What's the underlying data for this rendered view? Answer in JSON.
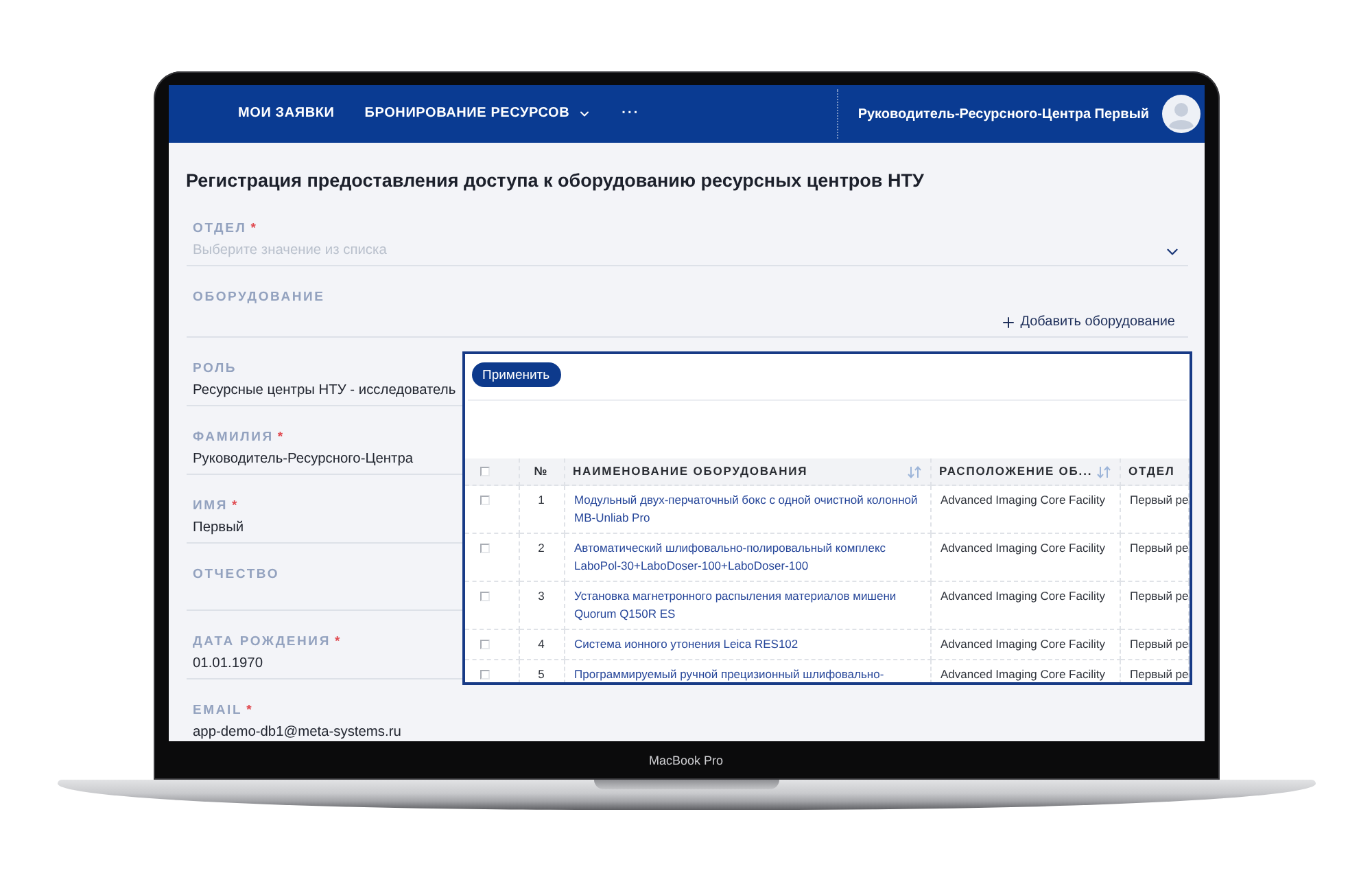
{
  "laptop": {
    "label": "MacBook Pro"
  },
  "nav": {
    "items": [
      {
        "kind": "link",
        "label": "МОИ ЗАЯВКИ"
      },
      {
        "kind": "dropdown",
        "label": "БРОНИРОВАНИЕ РЕСУРСОВ"
      },
      {
        "kind": "more",
        "label": "···"
      }
    ],
    "user": {
      "name": "Руководитель-Ресурсного-Центра Первый"
    }
  },
  "form": {
    "title": "Регистрация предоставления доступа к оборудованию ресурсных центров НТУ",
    "fields": [
      {
        "kind": "select",
        "label": "ОТДЕЛ",
        "required_mark": "*",
        "placeholder": "Выберите значение из списка"
      },
      {
        "kind": "action",
        "label": "ОБОРУДОВАНИЕ",
        "action": "Добавить оборудование"
      },
      {
        "kind": "text",
        "label": "РОЛЬ",
        "value": "Ресурсные центры НТУ - исследователь"
      },
      {
        "kind": "text",
        "label": "ФАМИЛИЯ",
        "required_mark": "*",
        "value": "Руководитель-Ресурсного-Центра"
      },
      {
        "kind": "text",
        "label": "ИМЯ",
        "required_mark": "*",
        "value": "Первый"
      },
      {
        "kind": "text",
        "label": "ОТЧЕСТВО"
      },
      {
        "kind": "text",
        "label": "ДАТА РОЖДЕНИЯ",
        "required_mark": "*",
        "value": "01.01.1970"
      },
      {
        "kind": "text",
        "label": "EMAIL",
        "required_mark": "*",
        "value": "app-demo-db1@meta-systems.ru"
      }
    ]
  },
  "picker": {
    "apply_button": "Применить",
    "table": {
      "header_checkbox": {
        "checked": false
      },
      "columns": [
        {
          "label": "№",
          "sortable": false
        },
        {
          "label": "НАИМЕНОВАНИЕ ОБОРУДОВАНИЯ",
          "sortable": true
        },
        {
          "label": "РАСПОЛОЖЕНИЕ ОБ...",
          "sortable": true
        },
        {
          "label": "ОТДЕЛ",
          "sortable": false
        }
      ],
      "rows": [
        {
          "checked": false,
          "number": "1",
          "name": "Модульный двух-перчаточный бокс с одной очистной колонной MB-Unliab Pro",
          "location": "Advanced Imaging Core Facility",
          "department": "Первый ре"
        },
        {
          "checked": false,
          "number": "2",
          "name": "Автоматический шлифовально-полировальный комплекс LaboPol-30+LaboDoser-100+LaboDoser-100",
          "location": "Advanced Imaging Core Facility",
          "department": "Первый ре"
        },
        {
          "checked": false,
          "number": "3",
          "name": "Установка магнетронного распыления материалов мишени Quorum Q150R ES",
          "location": "Advanced Imaging Core Facility",
          "department": "Первый ре"
        },
        {
          "checked": false,
          "number": "4",
          "name": "Система ионного утонения Leica RES102",
          "location": "Advanced Imaging Core Facility",
          "department": "Первый ре"
        },
        {
          "checked": false,
          "number": "5",
          "name": "Программируемый ручной прецизионный шлифовально-",
          "location": "Advanced Imaging Core Facility",
          "department": "Первый ре"
        }
      ]
    }
  }
}
